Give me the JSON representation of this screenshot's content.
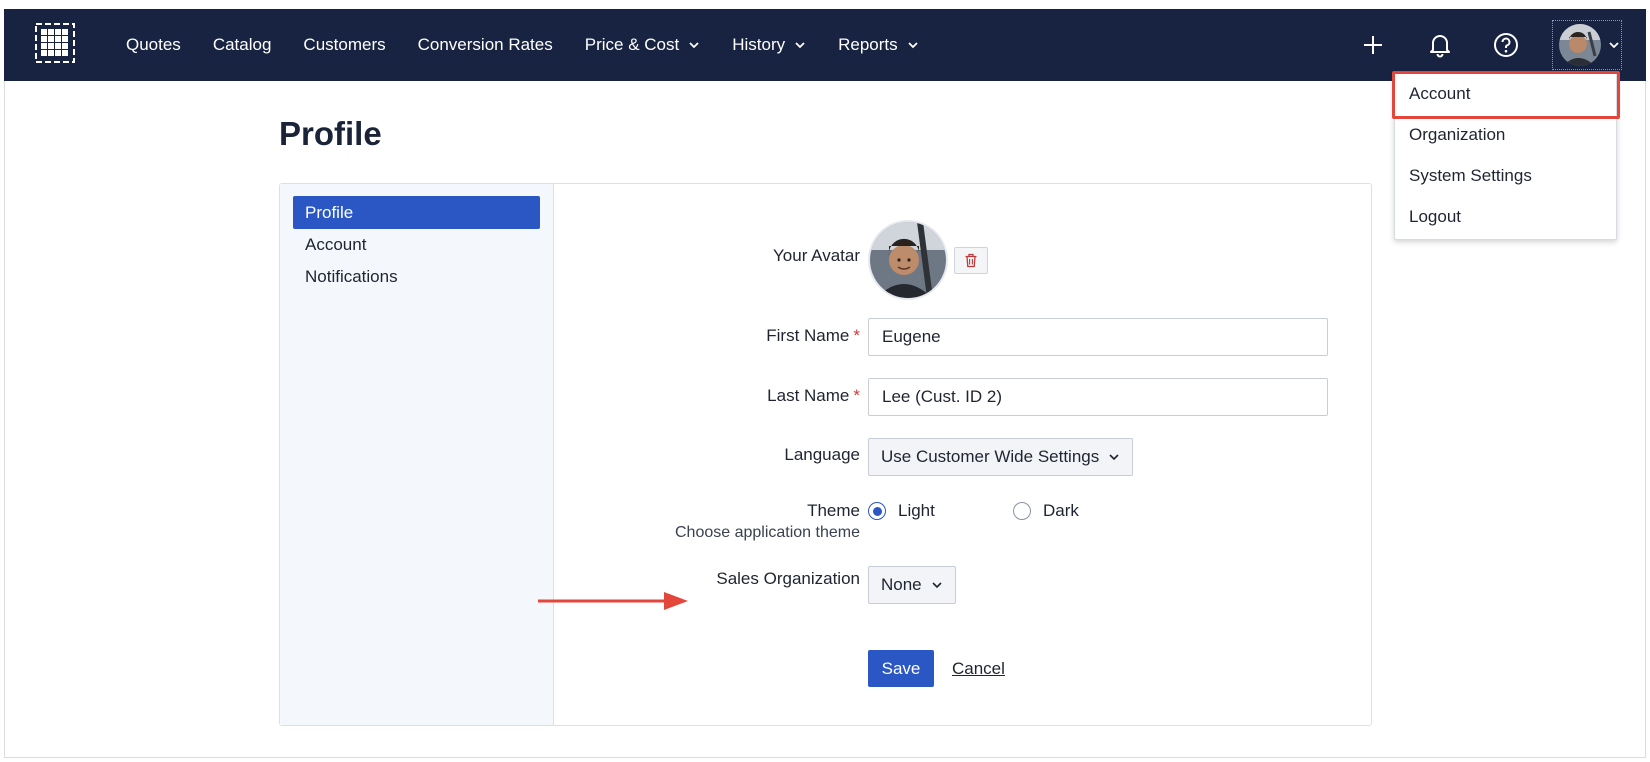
{
  "nav": {
    "items": [
      {
        "label": "Quotes",
        "dropdown": false
      },
      {
        "label": "Catalog",
        "dropdown": false
      },
      {
        "label": "Customers",
        "dropdown": false
      },
      {
        "label": "Conversion Rates",
        "dropdown": false
      },
      {
        "label": "Price & Cost",
        "dropdown": true
      },
      {
        "label": "History",
        "dropdown": true
      },
      {
        "label": "Reports",
        "dropdown": true
      }
    ],
    "icons": [
      "apps-grid-icon",
      "plus-icon",
      "bell-icon",
      "help-icon",
      "avatar",
      "chevron-down-icon"
    ]
  },
  "user_menu": {
    "items": [
      "Account",
      "Organization",
      "System Settings",
      "Logout"
    ],
    "highlighted": "Account"
  },
  "page": {
    "title": "Profile"
  },
  "sidebar": {
    "items": [
      "Profile",
      "Account",
      "Notifications"
    ],
    "active": "Profile"
  },
  "form": {
    "avatar_label": "Your Avatar",
    "first_name_label": "First Name",
    "first_name_value": "Eugene",
    "last_name_label": "Last Name",
    "last_name_value": "Lee (Cust. ID 2)",
    "required_mark": "*",
    "language_label": "Language",
    "language_value": "Use Customer Wide Settings",
    "theme_label": "Theme",
    "theme_sub": "Choose application theme",
    "theme_options": [
      "Light",
      "Dark"
    ],
    "theme_selected": "Light",
    "sales_org_label": "Sales Organization",
    "sales_org_value": "None",
    "save_label": "Save",
    "cancel_label": "Cancel"
  },
  "colors": {
    "topbar": "#172340",
    "primary": "#2a57c4",
    "highlight": "#e3463a",
    "required": "#d0393a"
  }
}
